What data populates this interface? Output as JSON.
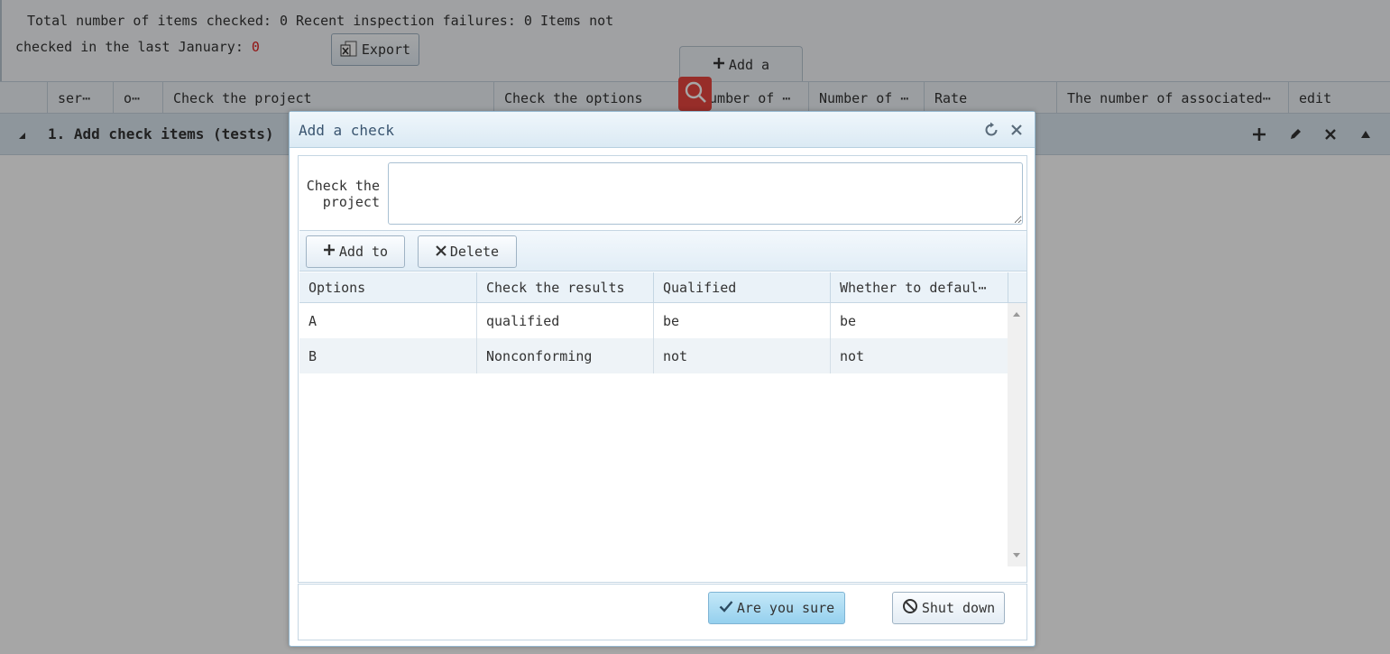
{
  "summary": {
    "line1": "Total number of items checked: 0   Recent inspection failures: 0   Items not",
    "line2_prefix": "checked in the last January: ",
    "line2_value": "0",
    "export_label": "Export",
    "add_tab_label": "Add a"
  },
  "grid": {
    "columns": [
      "ser⋯",
      "o⋯",
      "Check the project",
      "Check the options",
      "Number of ⋯",
      "Number of ⋯",
      "Rate",
      "The number of associated⋯",
      "edit"
    ],
    "group_title": "1. Add check items (tests)"
  },
  "dialog": {
    "title": "Add a check",
    "field_label": "Check the project",
    "field_value": "",
    "toolbar": {
      "add_label": "Add to",
      "delete_label": "Delete"
    },
    "table": {
      "columns": [
        "Options",
        "Check the results",
        "Qualified",
        "Whether to defaul⋯"
      ],
      "rows": [
        [
          "A",
          "qualified",
          "be",
          "be"
        ],
        [
          "B",
          "Nonconforming",
          "not",
          "not"
        ]
      ]
    },
    "footer": {
      "ok_label": "Are you sure",
      "close_label": "Shut down"
    }
  },
  "colors": {
    "accent": "#95d0ee",
    "danger": "#e9463f",
    "red_value": "#e02020"
  },
  "icons": [
    "excel-icon",
    "plus-icon",
    "search-icon",
    "refresh-icon",
    "close-icon",
    "pencil-icon",
    "collapse-triangle-icon",
    "delete-x-icon",
    "check-icon",
    "ban-icon",
    "resize-handle-icon"
  ]
}
